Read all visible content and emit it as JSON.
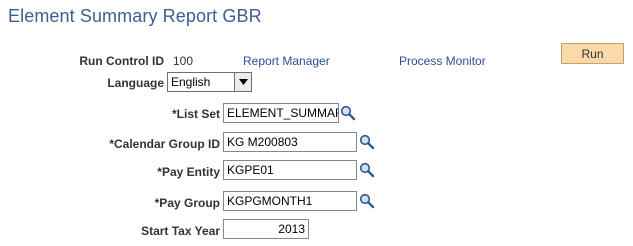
{
  "page": {
    "title": "Element Summary Report GBR"
  },
  "run_control": {
    "label": "Run Control ID",
    "value": "100",
    "report_manager_link": "Report Manager",
    "process_monitor_link": "Process Monitor",
    "run_button": "Run"
  },
  "fields": {
    "language": {
      "label": "Language",
      "value": "English"
    },
    "list_set": {
      "label": "*List Set",
      "value": "ELEMENT_SUMMAR"
    },
    "calendar_group_id": {
      "label": "*Calendar Group ID",
      "value": "KG M200803"
    },
    "pay_entity": {
      "label": "*Pay Entity",
      "value": "KGPE01"
    },
    "pay_group": {
      "label": "*Pay Group",
      "value": "KGPGMONTH1"
    },
    "start_tax_year": {
      "label": "Start Tax Year",
      "value": "2013"
    }
  },
  "icons": {
    "lookup": "magnifier-lookup-icon",
    "dropdown": "chevron-down-icon"
  },
  "colors": {
    "title": "#3c5f8f",
    "link": "#2b4f8f",
    "run_button": "#fbdaa9"
  }
}
